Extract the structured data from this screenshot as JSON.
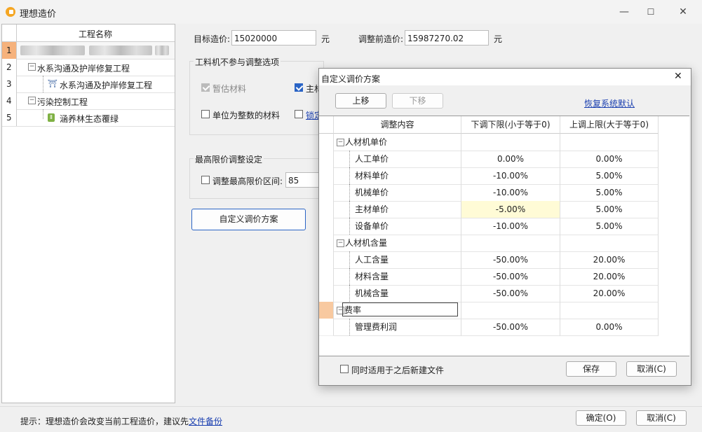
{
  "window": {
    "title": "理想造价",
    "minimize": "—",
    "maximize": "☐",
    "close": "✕",
    "icon": "app-logo-icon"
  },
  "tree": {
    "header": "工程名称",
    "rows": [
      {
        "num": "1",
        "label": ""
      },
      {
        "num": "2",
        "label": "水系沟通及护岸修复工程",
        "toggle": "⊖"
      },
      {
        "num": "3",
        "label": "水系沟通及护岸修复工程"
      },
      {
        "num": "4",
        "label": "污染控制工程",
        "toggle": "⊖"
      },
      {
        "num": "5",
        "label": "涵养林生态覆绿"
      }
    ]
  },
  "main": {
    "target_label": "目标造价:",
    "target_value": "15020000",
    "unit": "元",
    "before_label": "调整前造价:",
    "before_value": "15987270.02",
    "exclude_group_title": "工料机不参与调整选项",
    "opt_temp_material": "暂估材料",
    "opt_main_material": "主材",
    "opt_integer_unit": "单位为整数的材料",
    "opt_lock": "锁定",
    "max_group_title": "最高限价调整设定",
    "max_range_label": "调整最高限价区间:",
    "max_range_value": "85",
    "custom_scheme_button": "自定义调价方案",
    "hint_prefix": "提示：理想造价会改变当前工程造价，建议先",
    "hint_link": "文件备份",
    "ok_button": "确定(O)",
    "cancel_button": "取消(C)"
  },
  "dialog": {
    "title": "自定义调价方案",
    "close": "✕",
    "move_up": "上移",
    "move_down": "下移",
    "restore_default": "恢复系统默认",
    "columns": [
      "调整内容",
      "下调下限(小于等于0)",
      "上调上限(大于等于0)"
    ],
    "rows": [
      {
        "label": "人材机单价",
        "group": true,
        "toggle": "⊖",
        "lower": "",
        "upper": ""
      },
      {
        "label": "人工单价",
        "lower": "0.00%",
        "upper": "0.00%"
      },
      {
        "label": "材料单价",
        "lower": "-10.00%",
        "upper": "5.00%"
      },
      {
        "label": "机械单价",
        "lower": "-10.00%",
        "upper": "5.00%"
      },
      {
        "label": "主材单价",
        "lower": "-5.00%",
        "upper": "5.00%"
      },
      {
        "label": "设备单价",
        "lower": "-10.00%",
        "upper": "5.00%"
      },
      {
        "label": "人材机含量",
        "group": true,
        "toggle": "⊖",
        "lower": "",
        "upper": ""
      },
      {
        "label": "人工含量",
        "lower": "-50.00%",
        "upper": "20.00%"
      },
      {
        "label": "材料含量",
        "lower": "-50.00%",
        "upper": "20.00%"
      },
      {
        "label": "机械含量",
        "lower": "-50.00%",
        "upper": "20.00%"
      },
      {
        "label": "费率",
        "group": true,
        "toggle": "⊖",
        "lower": "",
        "upper": ""
      },
      {
        "label": "管理费利润",
        "lower": "-50.00%",
        "upper": "0.00%"
      }
    ],
    "apply_future_label": "同时适用于之后新建文件",
    "save_button": "保存",
    "cancel_button": "取消(C)"
  },
  "colors": {
    "accent": "#2a64c5",
    "selected_cell": "#fffbd6",
    "row_highlight": "#f8c9a0",
    "link": "#1a3fb0"
  }
}
